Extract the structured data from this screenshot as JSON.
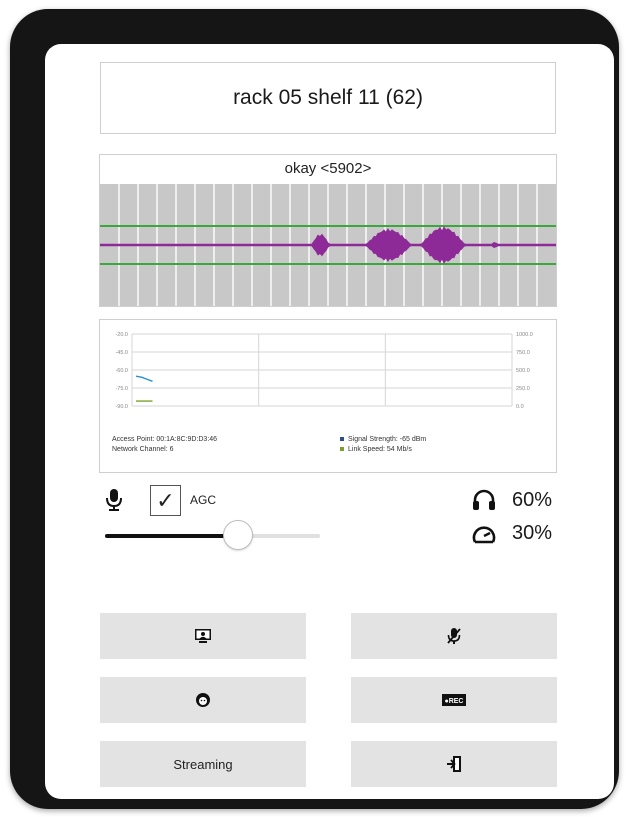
{
  "header": {
    "title": "rack 05 shelf 11 (62)"
  },
  "waveform": {
    "label": "okay <5902>",
    "colors": {
      "background": "#c8c8c8",
      "grid": "#ffffff",
      "band": "#3aa83a",
      "wave": "#8e2a98"
    }
  },
  "network": {
    "left_axis_ticks": [
      "-20.0",
      "-45.0",
      "-60.0",
      "-75.0",
      "-90.0"
    ],
    "right_axis_ticks": [
      "1000.0",
      "750.0",
      "500.0",
      "250.0",
      "0.0"
    ],
    "access_point": "Access Point: 00:1A:8C:9D:D3:46",
    "network_channel": "Network Channel: 6",
    "signal_strength": "Signal Strength: -65 dBm",
    "link_speed": "Link Speed: 54 Mb/s",
    "colors": {
      "signal": "#2a8fd6",
      "link": "#7aa02a",
      "grid": "#d6d6d6"
    }
  },
  "chart_data": {
    "type": "line",
    "title": "",
    "series": [
      {
        "name": "Signal Strength",
        "axis": "left",
        "x": [
          0,
          1,
          2,
          3
        ],
        "values": [
          -61,
          -62,
          -64,
          -66
        ]
      },
      {
        "name": "Link Speed",
        "axis": "right",
        "x": [
          0,
          1,
          2,
          3
        ],
        "values": [
          54,
          54,
          54,
          54
        ]
      }
    ],
    "ylim_left": [
      -90,
      -20
    ],
    "ylim_right": [
      0,
      1000
    ],
    "grid": true
  },
  "audio": {
    "mic_icon": "microphone-icon",
    "agc_checked": true,
    "agc_check_glyph": "✓",
    "agc_label": "AGC",
    "mic_gain_fraction": 0.62,
    "headphones_icon": "headphones-icon",
    "volume": "60%",
    "speed_icon": "speedometer-icon",
    "speed": "30%"
  },
  "buttons": {
    "screen_share_icon": "screen-share-icon",
    "mute_icon": "microphone-muted-icon",
    "operator_icon": "headset-operator-icon",
    "record_icon": "record-icon",
    "record_text": "●REC",
    "streaming_label": "Streaming",
    "exit_icon": "exit-door-icon"
  }
}
